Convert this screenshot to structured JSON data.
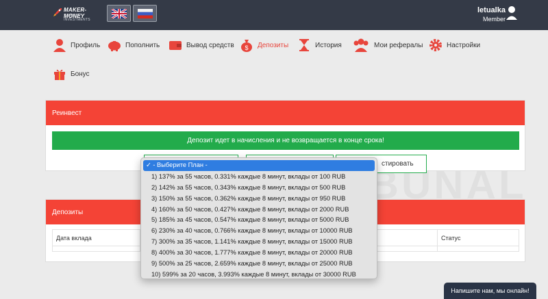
{
  "header": {
    "logo_title": "MAKER-MONEY",
    "logo_subtitle": "STARTUP INVESTMENTS",
    "username": "letualka",
    "role": "Member"
  },
  "nav": [
    {
      "label": "Профиль",
      "icon": "user-icon"
    },
    {
      "label": "Пополнить",
      "icon": "piggy-bank-icon"
    },
    {
      "label": "Вывод средств",
      "icon": "wallet-icon"
    },
    {
      "label": "Депозиты",
      "icon": "money-bag-icon",
      "active": true
    },
    {
      "label": "История",
      "icon": "hourglass-icon"
    },
    {
      "label": "Мои рефералы",
      "icon": "users-icon"
    },
    {
      "label": "Настройки",
      "icon": "gear-icon"
    },
    {
      "label": "Бонус",
      "icon": "gift-icon"
    }
  ],
  "reinvest": {
    "title": "Реинвест",
    "notice": "Депозит идет в начисления и не возвращается в конце срока!",
    "button_label": "стировать"
  },
  "plan_select": {
    "options": [
      "✓ - Выберите План -",
      "1) 137% за 55 часов, 0.331% каждые 8 минут, вклады от 100 RUB",
      "2) 142% за 55 часов, 0.343% каждые 8 минут, вклады от 500 RUB",
      "3) 150% за 55 часов, 0.362% каждые 8 минут, вклады от 950 RUB",
      "4) 160% за 50 часов, 0.427% каждые 8 минут, вклады от 2000 RUB",
      "5) 185% за 45 часов, 0.547% каждые 8 минут, вклады от 5000 RUB",
      "6) 230% за 40 часов, 0.766% каждые 8 минут, вклады от 10000 RUB",
      "7) 300% за 35 часов, 1.141% каждые 8 минут, вклады от 15000 RUB",
      "8) 400% за 30 часов, 1.777% каждые 8 минут, вклады от 20000 RUB",
      "9) 500% за 25 часов, 2.659% каждые 8 минут, вклады от 25000 RUB",
      "10) 599% за 20 часов, 3.993% каждые 8 минут, вклады от 30000 RUB"
    ]
  },
  "deposits": {
    "title": "Депозиты",
    "col_date": "Дата вклада",
    "col_status": "Статус"
  },
  "chat": {
    "label": "Напишите нам, мы онлайн!"
  },
  "colors": {
    "accent_red": "#f44336",
    "success_green": "#22ab4b",
    "header_dark": "#343a47"
  }
}
